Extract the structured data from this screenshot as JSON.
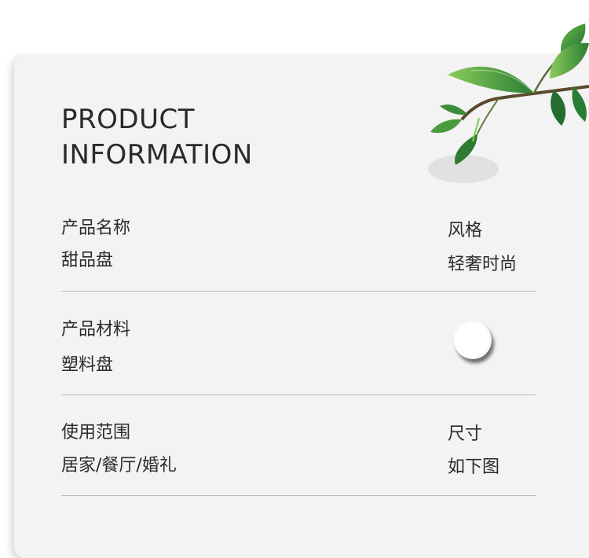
{
  "heading": {
    "line1": "PRODUCT",
    "line2": "INFORMATION"
  },
  "rows": [
    {
      "left_label": "产品名称",
      "left_value": "甜品盘",
      "right_label": "风格",
      "right_value": "轻奢时尚"
    },
    {
      "left_label": "产品材料",
      "left_value": "塑料盘"
    },
    {
      "left_label": "使用范围",
      "left_value": "居家/餐厅/婚礼",
      "right_label": "尺寸",
      "right_value": "如下图"
    }
  ],
  "colors": {
    "card_background": "#f3f3f3",
    "text": "#2b2b2b",
    "divider": "#bcbcbc",
    "leaf": "#2f8a3a"
  },
  "icons": {
    "knob": "white-circle-knob",
    "decoration": "green-leaf-branch"
  }
}
